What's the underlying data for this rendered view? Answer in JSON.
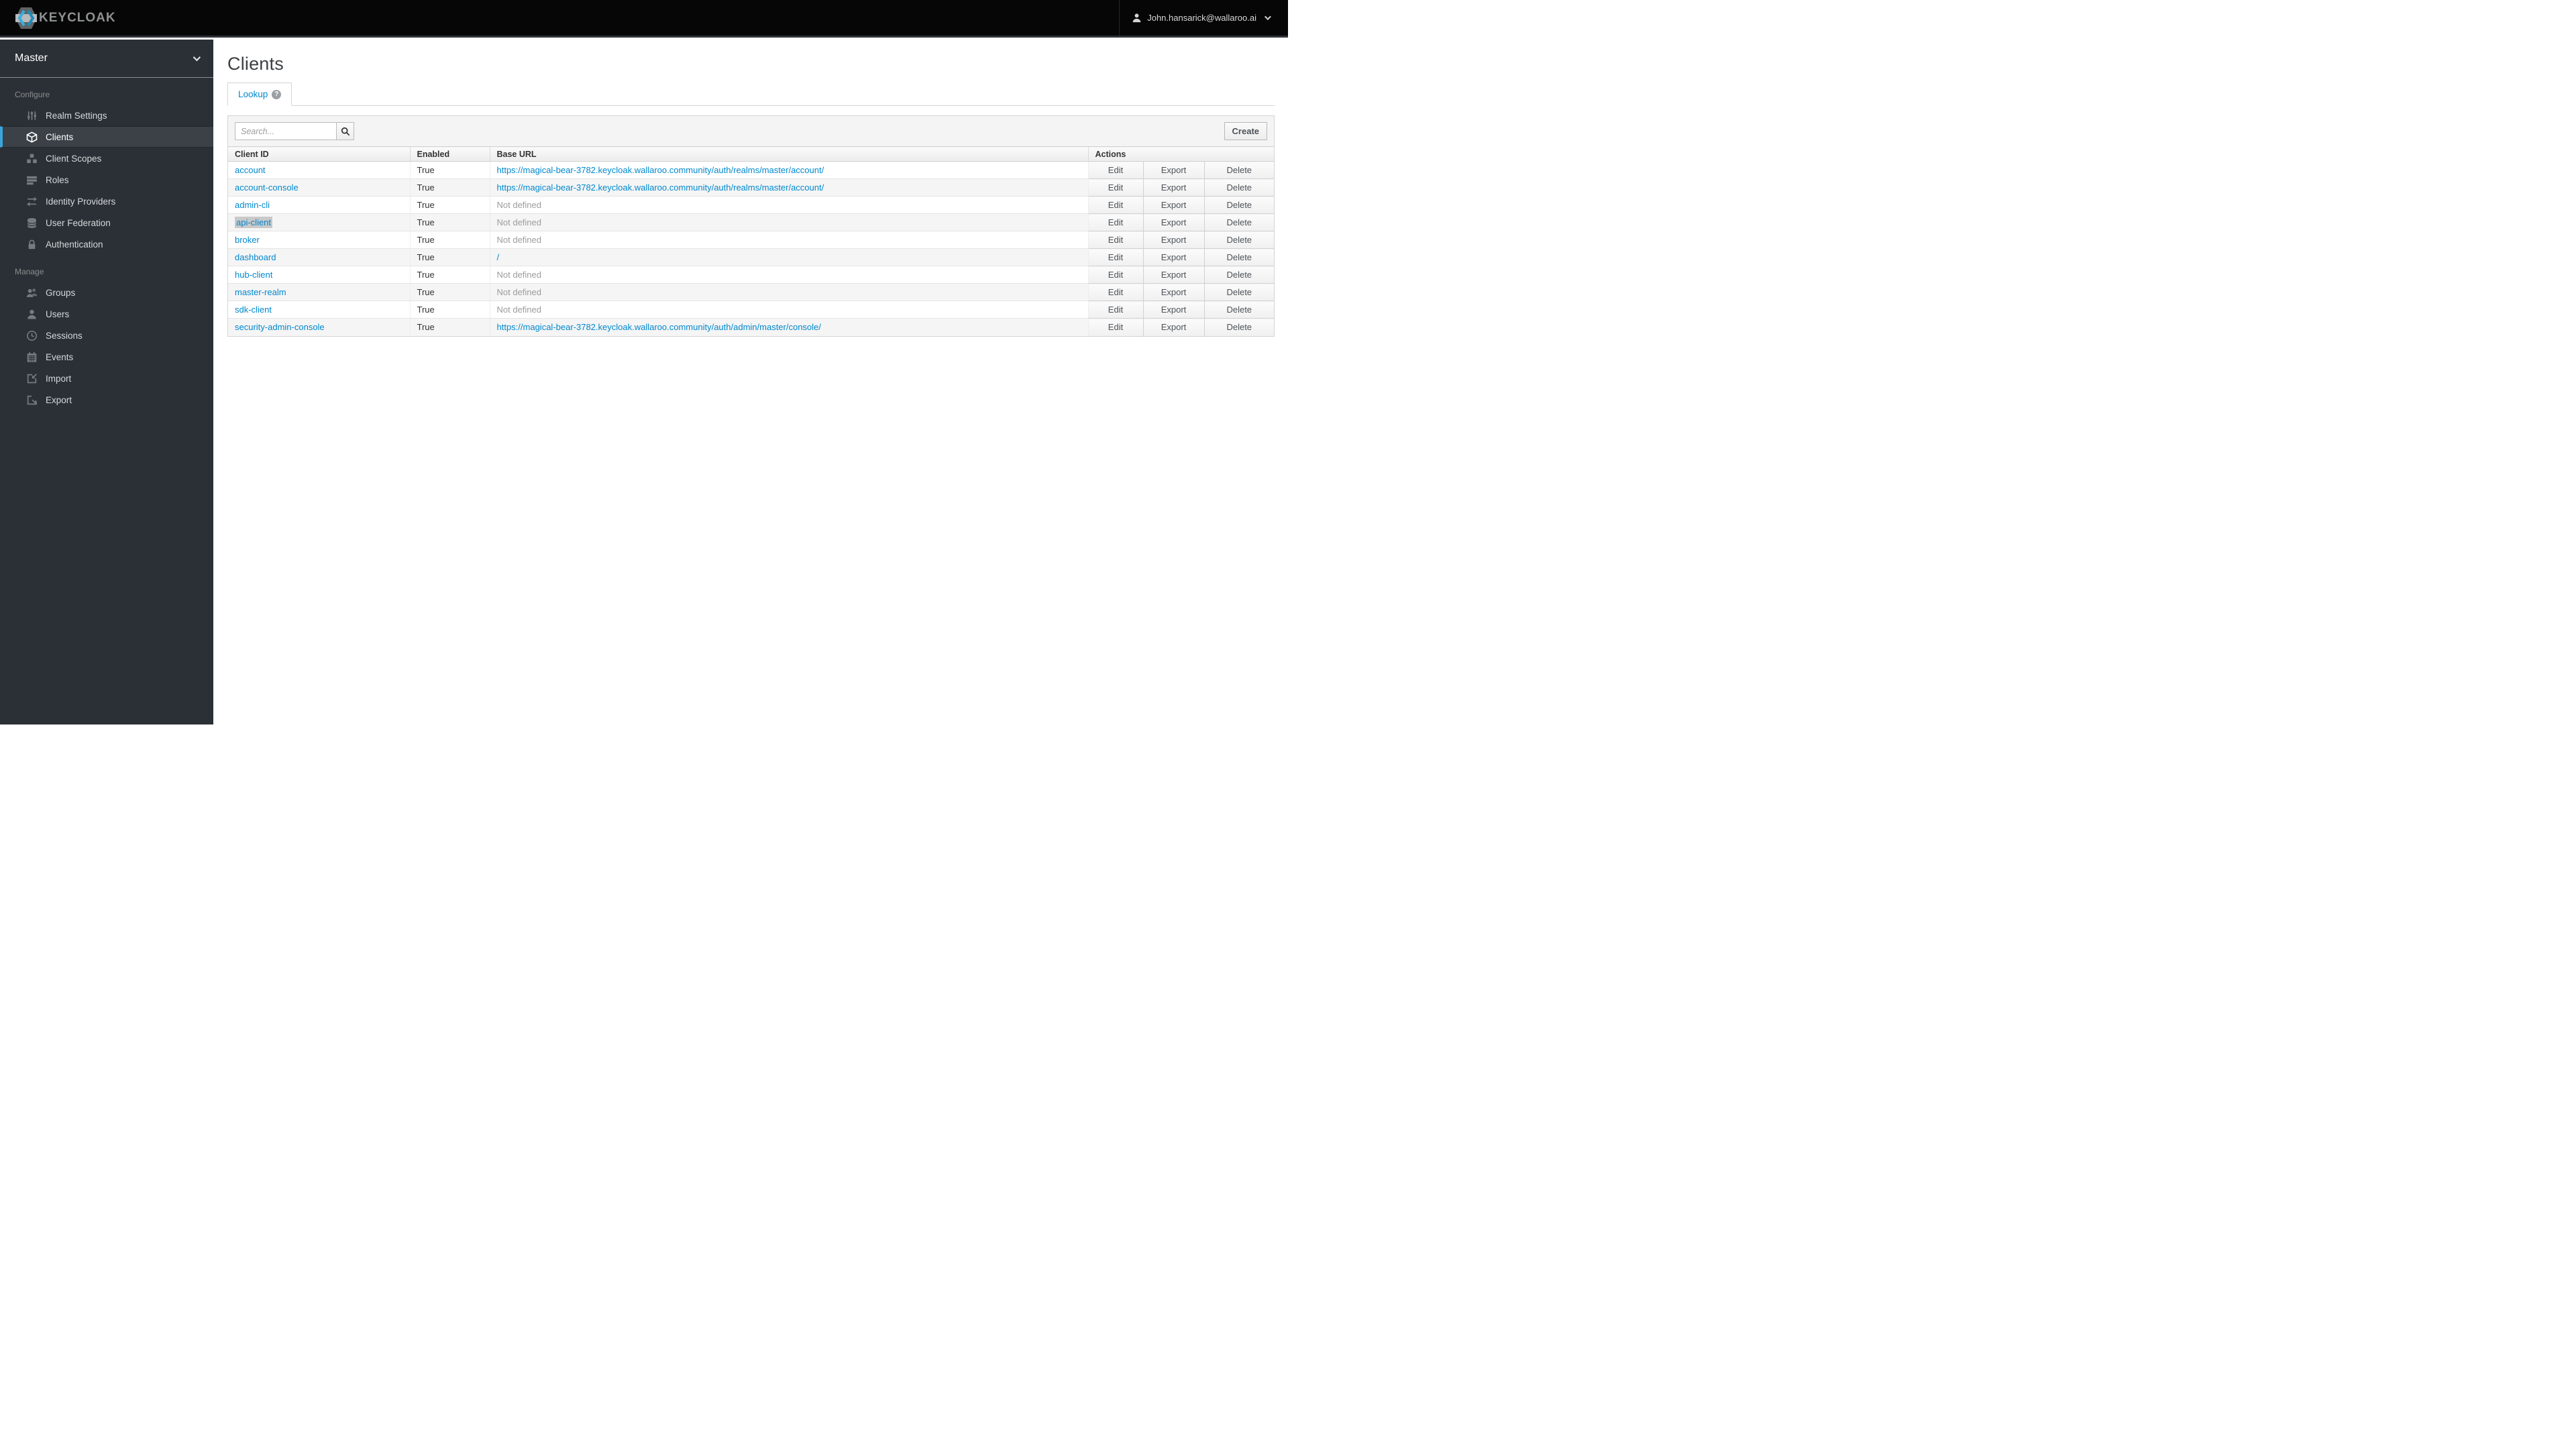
{
  "topbar": {
    "brand": "KEYCLOAK",
    "user": {
      "name": "John.hansarick@wallaroo.ai"
    }
  },
  "sidebar": {
    "realm": "Master",
    "sections": [
      {
        "label": "Configure",
        "items": [
          {
            "label": "Realm Settings",
            "icon": "sliders-icon",
            "active": false
          },
          {
            "label": "Clients",
            "icon": "cube-icon",
            "active": true
          },
          {
            "label": "Client Scopes",
            "icon": "cubes-icon",
            "active": false
          },
          {
            "label": "Roles",
            "icon": "roles-list-icon",
            "active": false
          },
          {
            "label": "Identity Providers",
            "icon": "exchange-arrows-icon",
            "active": false
          },
          {
            "label": "User Federation",
            "icon": "database-icon",
            "active": false
          },
          {
            "label": "Authentication",
            "icon": "lock-icon",
            "active": false
          }
        ]
      },
      {
        "label": "Manage",
        "items": [
          {
            "label": "Groups",
            "icon": "users-icon",
            "active": false
          },
          {
            "label": "Users",
            "icon": "user-icon",
            "active": false
          },
          {
            "label": "Sessions",
            "icon": "clock-icon",
            "active": false
          },
          {
            "label": "Events",
            "icon": "calendar-icon",
            "active": false
          },
          {
            "label": "Import",
            "icon": "import-icon",
            "active": false
          },
          {
            "label": "Export",
            "icon": "export-icon",
            "active": false
          }
        ]
      }
    ]
  },
  "main": {
    "title": "Clients",
    "tab": {
      "label": "Lookup"
    },
    "toolbar": {
      "search_placeholder": "Search...",
      "create_label": "Create"
    },
    "table": {
      "columns": [
        "Client ID",
        "Enabled",
        "Base URL",
        "Actions"
      ],
      "actions": [
        "Edit",
        "Export",
        "Delete"
      ],
      "rows": [
        {
          "client_id": "account",
          "enabled": "True",
          "base_url": "https://magical-bear-3782.keycloak.wallaroo.community/auth/realms/master/account/",
          "url_is_link": true,
          "highlighted": false
        },
        {
          "client_id": "account-console",
          "enabled": "True",
          "base_url": "https://magical-bear-3782.keycloak.wallaroo.community/auth/realms/master/account/",
          "url_is_link": true,
          "highlighted": false
        },
        {
          "client_id": "admin-cli",
          "enabled": "True",
          "base_url": "Not defined",
          "url_is_link": false,
          "highlighted": false
        },
        {
          "client_id": "api-client",
          "enabled": "True",
          "base_url": "Not defined",
          "url_is_link": false,
          "highlighted": true
        },
        {
          "client_id": "broker",
          "enabled": "True",
          "base_url": "Not defined",
          "url_is_link": false,
          "highlighted": false
        },
        {
          "client_id": "dashboard",
          "enabled": "True",
          "base_url": "/",
          "url_is_link": true,
          "highlighted": false
        },
        {
          "client_id": "hub-client",
          "enabled": "True",
          "base_url": "Not defined",
          "url_is_link": false,
          "highlighted": false
        },
        {
          "client_id": "master-realm",
          "enabled": "True",
          "base_url": "Not defined",
          "url_is_link": false,
          "highlighted": false
        },
        {
          "client_id": "sdk-client",
          "enabled": "True",
          "base_url": "Not defined",
          "url_is_link": false,
          "highlighted": false
        },
        {
          "client_id": "security-admin-console",
          "enabled": "True",
          "base_url": "https://magical-bear-3782.keycloak.wallaroo.community/auth/admin/master/console/",
          "url_is_link": true,
          "highlighted": false
        }
      ]
    }
  },
  "colors": {
    "accent_blue": "#0088ce",
    "active_indicator": "#39a5dc",
    "sidebar_bg": "#2b3036",
    "topbar_bg": "#060606",
    "muted_text": "#9c9c9c"
  }
}
